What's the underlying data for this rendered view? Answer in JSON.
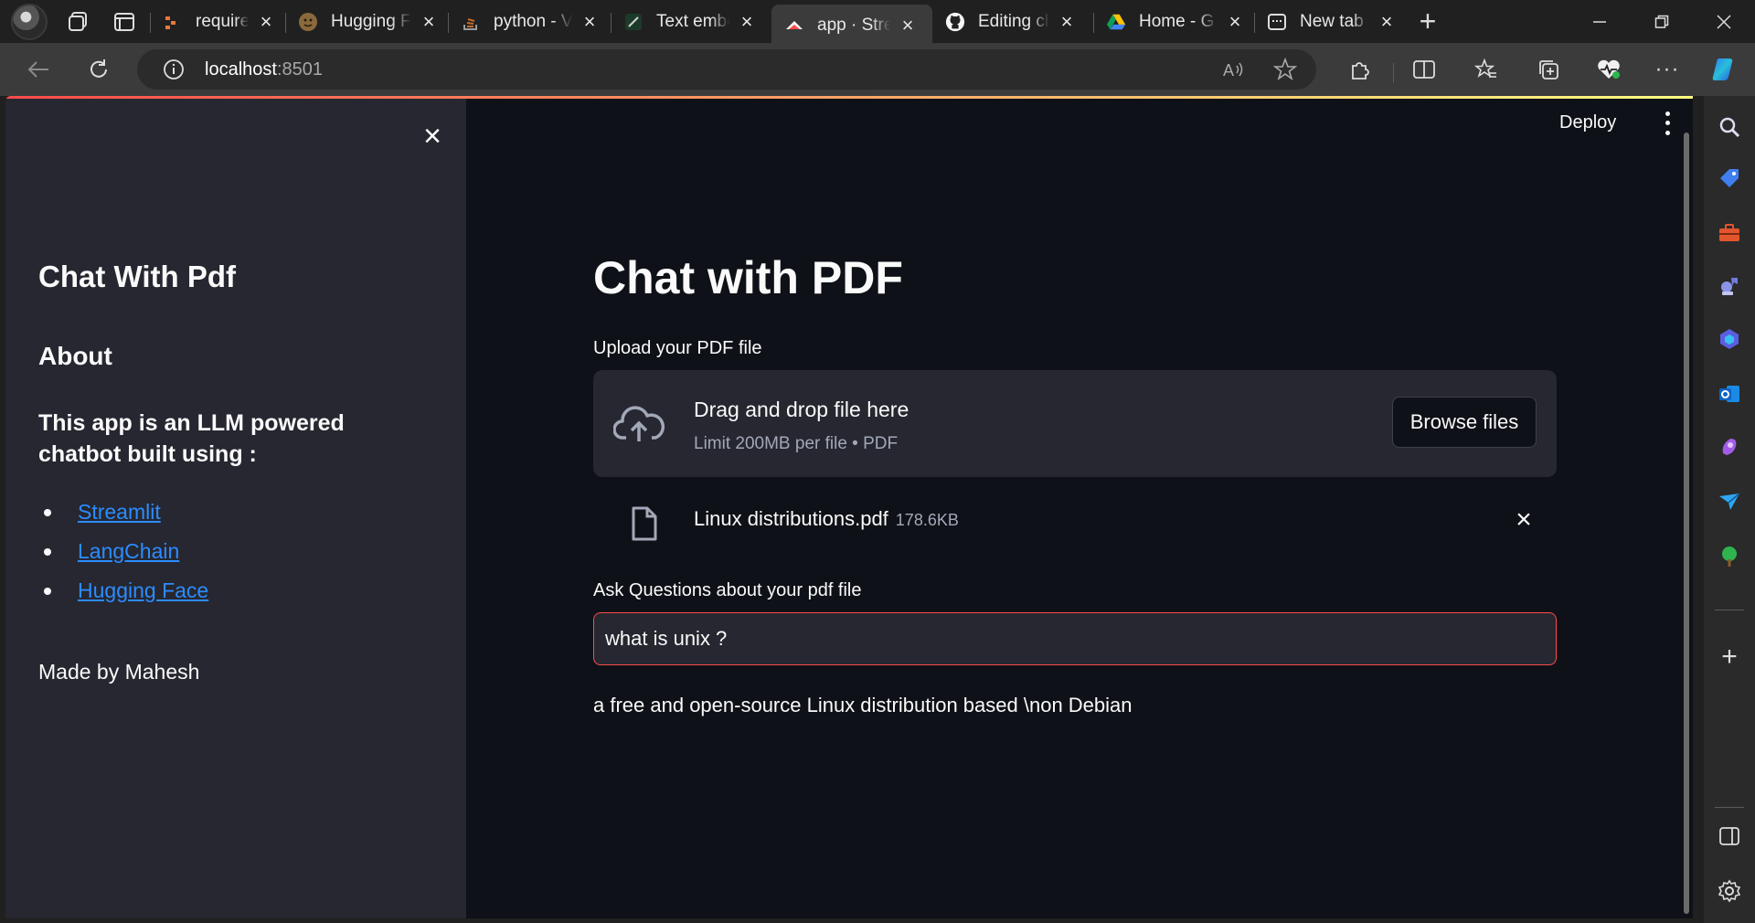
{
  "browser": {
    "tabs": [
      {
        "title": "requireme",
        "icon": "huggingface-file-icon",
        "active": false
      },
      {
        "title": "Hugging F",
        "icon": "hugging-face-icon",
        "active": false
      },
      {
        "title": "python - V",
        "icon": "stackoverflow-icon",
        "active": false
      },
      {
        "title": "Text embe",
        "icon": "langchain-icon",
        "active": false
      },
      {
        "title": "app · Strea",
        "icon": "streamlit-icon",
        "active": true
      },
      {
        "title": "Editing ch",
        "icon": "github-icon",
        "active": false
      },
      {
        "title": "Home - G",
        "icon": "google-drive-icon",
        "active": false
      },
      {
        "title": "New tab",
        "icon": "new-tab-icon",
        "active": false
      }
    ],
    "url_host": "localhost",
    "url_port": ":8501"
  },
  "app": {
    "deploy_label": "Deploy",
    "sidebar": {
      "title": "Chat With Pdf",
      "about_heading": "About",
      "description": "This app is an LLM powered chatbot built using :",
      "links": [
        {
          "label": "Streamlit"
        },
        {
          "label": "LangChain"
        },
        {
          "label": "Hugging Face"
        }
      ],
      "made_by": "Made by Mahesh"
    },
    "main": {
      "title": "Chat with PDF",
      "upload_label": "Upload your PDF file",
      "dropzone_text": "Drag and drop file here",
      "dropzone_limit": "Limit 200MB per file • PDF",
      "browse_label": "Browse files",
      "file_name": "Linux distributions.pdf",
      "file_size": "178.6KB",
      "question_label": "Ask Questions about your pdf file",
      "question_value": "what is unix ?",
      "answer": "a free and open-source Linux distribution based \\non Debian"
    }
  },
  "colors": {
    "app_bg": "#0e1117",
    "sidebar_bg": "#262730",
    "accent_red": "#ff4b4b",
    "link_blue": "#2c8cff"
  }
}
